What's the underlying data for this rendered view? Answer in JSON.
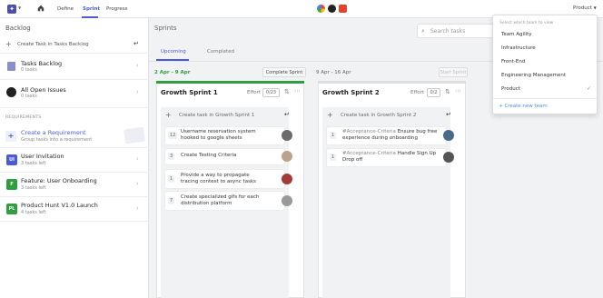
{
  "nav": {
    "items": [
      "Define",
      "Sprint",
      "Progress"
    ],
    "product": "Product"
  },
  "colors": {
    "accent": "#4b5bd6",
    "sprint1_bar": "#2e9e3f",
    "sprint2_bar": "#dddddd"
  },
  "sidebar": {
    "title": "Backlog",
    "create_label": "Create Task in Tasks Backlog",
    "tasks_backlog": {
      "name": "Tasks Backlog",
      "sub": "0 tasks"
    },
    "open_issues": {
      "name": "All Open Issues",
      "sub": "0 tasks"
    },
    "requirements_header": "REQUIREMENTS",
    "create_requirement": {
      "name": "Create a Requirement",
      "sub": "Group tasks into a requirement"
    },
    "requirements": [
      {
        "badge": "UI",
        "name": "User Invitation",
        "sub": "3 tasks left",
        "color": "#4b5bd6"
      },
      {
        "badge": "F",
        "name": "Feature: User Onboarding",
        "sub": "3 tasks left",
        "color": "#2e9e3f"
      },
      {
        "badge": "PL",
        "name": "Product Hunt V1.0 Launch",
        "sub": "4 tasks left",
        "color": "#2e9e3f"
      }
    ]
  },
  "main": {
    "title": "Sprints",
    "search_placeholder": "Search tasks",
    "tabs": [
      "Upcoming",
      "Completed"
    ],
    "sprint1": {
      "dates": "2 Apr - 9 Apr",
      "button": "Complete Sprint",
      "title": "Growth Sprint 1",
      "effort_label": "Effort",
      "effort": "0/23",
      "create": "Create task in Growth Sprint 1",
      "cards": [
        {
          "num": "12",
          "text": "Username reservation system hooked to google sheets",
          "avatar": "#6b6b6b"
        },
        {
          "num": "3",
          "text": "Create Testing Criteria",
          "avatar": "#b9a38a"
        },
        {
          "num": "1",
          "text": "Provide a way to propagate tracing context to async tasks",
          "avatar": "#a33b3b"
        },
        {
          "num": "7",
          "text": "Create specialized gifs for each distribution platform",
          "avatar": "#999999"
        }
      ]
    },
    "sprint2": {
      "dates": "9 Apr - 16 Apr",
      "button": "Start Sprint",
      "title": "Growth Sprint 2",
      "effort_label": "Effort",
      "effort": "0/2",
      "create": "Create task in Growth Sprint 2",
      "cards": [
        {
          "num": "1",
          "tag": "#Acceptance-Criteria",
          "text": "Ensure bug free experience during onboarding",
          "avatar": "#4a6a8a"
        },
        {
          "num": "1",
          "tag": "#Acceptance-Criteria",
          "text": "Handle Sign Up Drop off",
          "avatar": "#555555"
        }
      ]
    }
  },
  "dropdown": {
    "hint": "Select which team to view",
    "items": [
      "Team Agility",
      "Infrastructure",
      "Front-End",
      "Engineering Management",
      "Product"
    ],
    "selected_index": 4,
    "create": "Create new team"
  }
}
